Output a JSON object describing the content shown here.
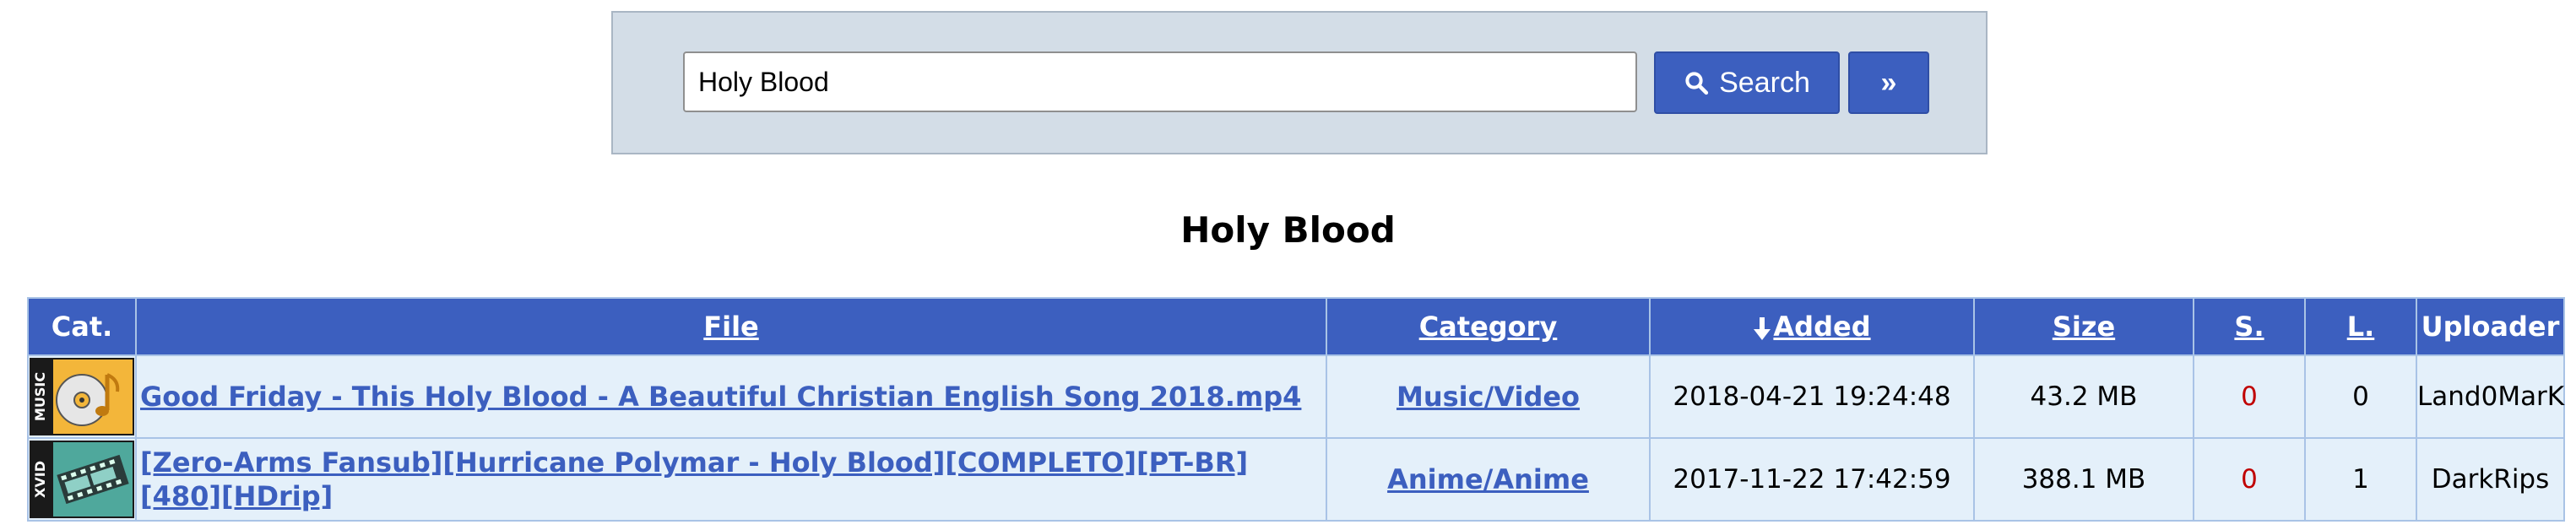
{
  "search": {
    "value": "Holy Blood",
    "button_label": "Search",
    "more_label": "»"
  },
  "page_title": "Holy Blood",
  "table": {
    "columns": {
      "cat": "Cat.",
      "file": "File",
      "category": "Category",
      "added": "Added",
      "size": "Size",
      "seeders": "S.",
      "leechers": "L.",
      "uploader": "Uploader"
    },
    "sort_icon": "arrow-down-icon",
    "rows": [
      {
        "cat_icon": "music-category-icon",
        "cat_icon_text": "MUSIC",
        "file": "Good Friday - This Holy Blood - A Beautiful Christian English Song 2018.mp4",
        "category": "Music/Video",
        "added": "2018-04-21 19:24:48",
        "size": "43.2 MB",
        "seeders": "0",
        "leechers": "0",
        "uploader": "Land0MarK"
      },
      {
        "cat_icon": "xvid-category-icon",
        "cat_icon_text": "XVID",
        "file": "[Zero-Arms Fansub][Hurricane Polymar - Holy Blood][COMPLETO][PT-BR][480][HDrip]",
        "category": "Anime/Anime",
        "added": "2017-11-22 17:42:59",
        "size": "388.1 MB",
        "seeders": "0",
        "leechers": "1",
        "uploader": "DarkRips"
      }
    ]
  },
  "colors": {
    "header_bg": "#3c5fbf",
    "row_bg": "#e4f0fa",
    "panel_bg": "#d3dde7",
    "link": "#3c5fbf",
    "seed_red": "#c00000"
  }
}
